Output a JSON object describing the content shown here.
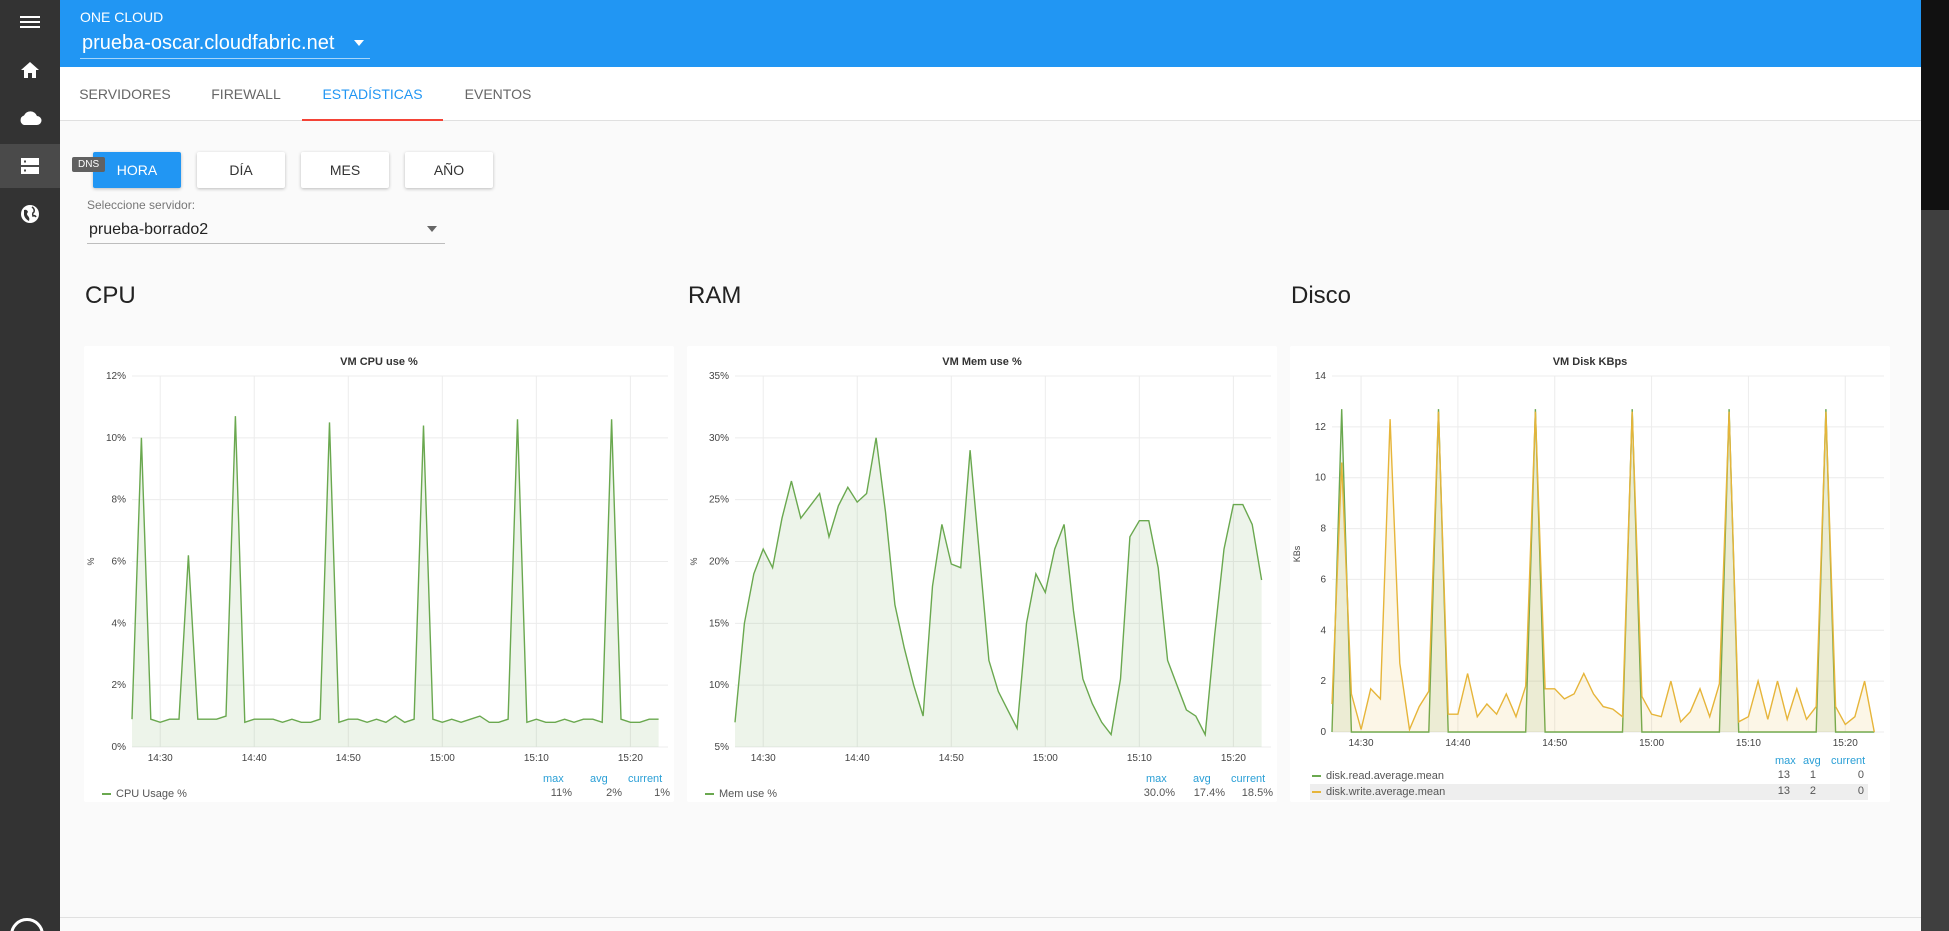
{
  "app": {
    "brand": "ONE CLOUD",
    "domain": "prueba-oscar.cloudfabric.net"
  },
  "rail": {
    "icons": [
      "menu-icon",
      "home-icon",
      "cloud-icon",
      "dns-icon",
      "globe-icon"
    ],
    "tooltip": "DNS"
  },
  "tabs": [
    {
      "label": "SERVIDORES"
    },
    {
      "label": "FIREWALL"
    },
    {
      "label": "ESTADÍSTICAS",
      "active": true
    },
    {
      "label": "EVENTOS"
    }
  ],
  "periods": [
    {
      "label": "HORA",
      "active": true
    },
    {
      "label": "DÍA"
    },
    {
      "label": "MES"
    },
    {
      "label": "AÑO"
    }
  ],
  "server_select": {
    "label": "Seleccione servidor:",
    "value": "prueba-borrado2"
  },
  "sections": {
    "cpu": "CPU",
    "ram": "RAM",
    "disk": "Disco"
  },
  "legend_headers": {
    "max": "max",
    "avg": "avg",
    "current": "current"
  },
  "colors": {
    "accent": "#2196f3",
    "tab_indicator": "#f44336",
    "series_green": "#6aa84f",
    "series_yellow": "#e6b53a"
  },
  "chart_data": [
    {
      "type": "area",
      "title": "VM CPU use %",
      "ylabel": "%",
      "ylim": [
        0,
        12
      ],
      "yticks": [
        "0%",
        "2%",
        "4%",
        "6%",
        "8%",
        "10%",
        "12%"
      ],
      "xticks": [
        "14:30",
        "14:40",
        "14:50",
        "15:00",
        "15:10",
        "15:20"
      ],
      "xrange_minutes": [
        -3,
        54
      ],
      "series": [
        {
          "name": "CPU Usage %",
          "color": "#6aa84f",
          "max": "11%",
          "avg": "2%",
          "current": "1%",
          "values": [
            0.9,
            10.0,
            0.9,
            0.8,
            0.9,
            0.9,
            6.2,
            0.9,
            0.9,
            0.9,
            1.0,
            10.7,
            0.8,
            0.9,
            0.9,
            0.9,
            0.8,
            0.9,
            0.8,
            0.8,
            0.9,
            10.5,
            0.8,
            0.9,
            0.9,
            0.8,
            0.9,
            0.8,
            1.0,
            0.8,
            0.9,
            10.4,
            0.9,
            0.8,
            0.9,
            0.8,
            0.9,
            1.0,
            0.8,
            0.8,
            0.9,
            10.6,
            0.8,
            0.9,
            0.8,
            0.8,
            0.9,
            0.8,
            0.9,
            0.9,
            0.8,
            10.6,
            0.9,
            0.8,
            0.8,
            0.9,
            0.9
          ]
        }
      ]
    },
    {
      "type": "area",
      "title": "VM Mem use %",
      "ylabel": "%",
      "ylim": [
        5,
        35
      ],
      "yticks": [
        "5%",
        "10%",
        "15%",
        "20%",
        "25%",
        "30%",
        "35%"
      ],
      "xticks": [
        "14:30",
        "14:40",
        "14:50",
        "15:00",
        "15:10",
        "15:20"
      ],
      "xrange_minutes": [
        -3,
        54
      ],
      "series": [
        {
          "name": "Mem use %",
          "color": "#6aa84f",
          "max": "30.0%",
          "avg": "17.4%",
          "current": "18.5%",
          "values": [
            7.0,
            15.0,
            19.0,
            21.0,
            19.5,
            23.5,
            26.5,
            23.5,
            24.5,
            25.5,
            22.0,
            24.5,
            26.0,
            24.8,
            25.5,
            30.0,
            24.0,
            16.5,
            13.0,
            10.0,
            7.5,
            18.0,
            23.0,
            19.8,
            19.5,
            29.0,
            20.5,
            12.0,
            9.5,
            8.0,
            6.5,
            15.0,
            19.0,
            17.5,
            21.0,
            23.0,
            16.0,
            10.5,
            8.5,
            7.0,
            6.0,
            10.5,
            22.0,
            23.3,
            23.3,
            19.5,
            12.0,
            10.0,
            8.0,
            7.5,
            6.0,
            14.0,
            21.0,
            24.6,
            24.6,
            23.0,
            18.5
          ]
        }
      ]
    },
    {
      "type": "area",
      "title": "VM Disk KBps",
      "ylabel": "KBs",
      "ylim": [
        0,
        14
      ],
      "yticks": [
        "0",
        "2",
        "4",
        "6",
        "8",
        "10",
        "12",
        "14"
      ],
      "xticks": [
        "14:30",
        "14:40",
        "14:50",
        "15:00",
        "15:10",
        "15:20"
      ],
      "xrange_minutes": [
        -3,
        54
      ],
      "series": [
        {
          "name": "disk.read.average.mean",
          "color": "#6aa84f",
          "max": "13",
          "avg": "1",
          "current": "0",
          "values": [
            0,
            12.7,
            0,
            0,
            0,
            0,
            0,
            0,
            0,
            0,
            0,
            12.7,
            0,
            0,
            0,
            0,
            0,
            0,
            0,
            0,
            0,
            12.7,
            0,
            0,
            0,
            0,
            0,
            0,
            0,
            0,
            0,
            12.7,
            0,
            0,
            0,
            0,
            0,
            0,
            0,
            0,
            0,
            12.7,
            0,
            0,
            0,
            0,
            0,
            0,
            0,
            0,
            0,
            12.7,
            0,
            0,
            0,
            0,
            0
          ]
        },
        {
          "name": "disk.write.average.mean",
          "color": "#e6b53a",
          "max": "13",
          "avg": "2",
          "current": "0",
          "values": [
            1.1,
            10.6,
            1.5,
            0.1,
            1.7,
            1.3,
            12.3,
            2.7,
            0.1,
            1.0,
            1.6,
            12.6,
            0.7,
            0.7,
            2.3,
            0.6,
            1.1,
            0.7,
            1.5,
            0.6,
            1.8,
            12.6,
            1.7,
            1.7,
            1.3,
            1.5,
            2.3,
            1.5,
            1.0,
            0.9,
            0.6,
            12.6,
            1.4,
            0.7,
            0.6,
            2.0,
            0.4,
            0.8,
            1.7,
            0.6,
            1.9,
            12.6,
            0.4,
            0.6,
            2.0,
            0.5,
            2.0,
            0.5,
            1.7,
            0.5,
            1.0,
            12.6,
            1.0,
            0.3,
            0.6,
            2.0,
            0
          ]
        }
      ]
    }
  ]
}
